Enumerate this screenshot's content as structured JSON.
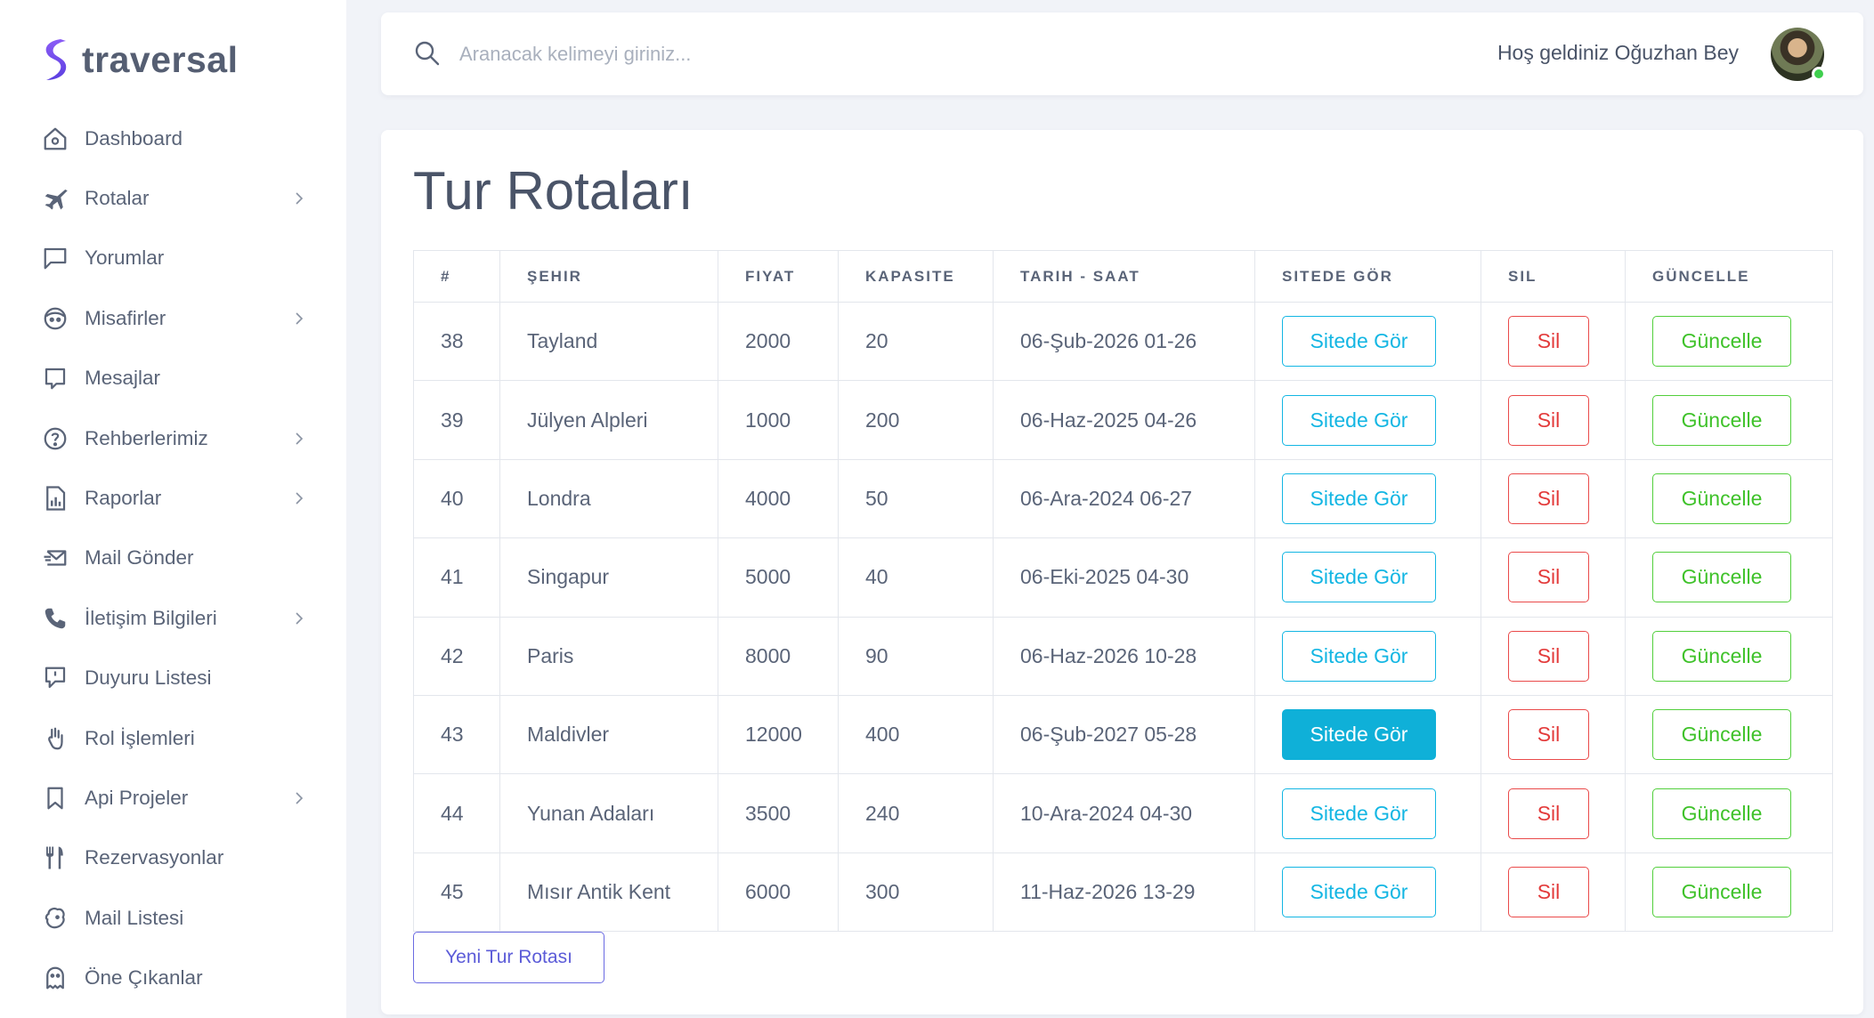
{
  "brand": {
    "name": "traversal",
    "accent": "#6c4cf4"
  },
  "sidebar": {
    "items": [
      {
        "label": "Dashboard",
        "icon": "home-icon",
        "has_children": false
      },
      {
        "label": "Rotalar",
        "icon": "plane-icon",
        "has_children": true
      },
      {
        "label": "Yorumlar",
        "icon": "message-square-icon",
        "has_children": false
      },
      {
        "label": "Misafirler",
        "icon": "face-icon",
        "has_children": true
      },
      {
        "label": "Mesajlar",
        "icon": "chat-icon",
        "has_children": false
      },
      {
        "label": "Rehberlerimiz",
        "icon": "help-circle-icon",
        "has_children": true
      },
      {
        "label": "Raporlar",
        "icon": "report-file-icon",
        "has_children": true
      },
      {
        "label": "Mail Gönder",
        "icon": "mail-send-icon",
        "has_children": false
      },
      {
        "label": "İletişim Bilgileri",
        "icon": "phone-icon",
        "has_children": true
      },
      {
        "label": "Duyuru Listesi",
        "icon": "announcement-icon",
        "has_children": false
      },
      {
        "label": "Rol İşlemleri",
        "icon": "hand-icon",
        "has_children": false
      },
      {
        "label": "Api Projeler",
        "icon": "bookmark-icon",
        "has_children": true
      },
      {
        "label": "Rezervasyonlar",
        "icon": "fork-knife-icon",
        "has_children": false
      },
      {
        "label": "Mail Listesi",
        "icon": "mailchimp-icon",
        "has_children": false
      },
      {
        "label": "Öne Çıkanlar",
        "icon": "ghost-icon",
        "has_children": false
      }
    ]
  },
  "header": {
    "search_placeholder": "Aranacak kelimeyi giriniz...",
    "welcome_text": "Hoş geldiniz Oğuzhan Bey",
    "online_status_color": "#3fcf4e"
  },
  "main": {
    "title": "Tur Rotaları",
    "columns": [
      "#",
      "ŞEHIR",
      "FIYAT",
      "KAPASITE",
      "TARIH - SAAT",
      "SITEDE GÖR",
      "SIL",
      "GÜNCELLE"
    ],
    "rows": [
      {
        "id": "38",
        "city": "Tayland",
        "price": "2000",
        "capacity": "20",
        "datetime": "06-Şub-2026 01-26",
        "view_label": "Sitede Gör",
        "delete_label": "Sil",
        "update_label": "Güncelle",
        "view_active": false
      },
      {
        "id": "39",
        "city": "Jülyen Alpleri",
        "price": "1000",
        "capacity": "200",
        "datetime": "06-Haz-2025 04-26",
        "view_label": "Sitede Gör",
        "delete_label": "Sil",
        "update_label": "Güncelle",
        "view_active": false
      },
      {
        "id": "40",
        "city": "Londra",
        "price": "4000",
        "capacity": "50",
        "datetime": "06-Ara-2024 06-27",
        "view_label": "Sitede Gör",
        "delete_label": "Sil",
        "update_label": "Güncelle",
        "view_active": false
      },
      {
        "id": "41",
        "city": "Singapur",
        "price": "5000",
        "capacity": "40",
        "datetime": "06-Eki-2025 04-30",
        "view_label": "Sitede Gör",
        "delete_label": "Sil",
        "update_label": "Güncelle",
        "view_active": false
      },
      {
        "id": "42",
        "city": "Paris",
        "price": "8000",
        "capacity": "90",
        "datetime": "06-Haz-2026 10-28",
        "view_label": "Sitede Gör",
        "delete_label": "Sil",
        "update_label": "Güncelle",
        "view_active": false
      },
      {
        "id": "43",
        "city": "Maldivler",
        "price": "12000",
        "capacity": "400",
        "datetime": "06-Şub-2027 05-28",
        "view_label": "Sitede Gör",
        "delete_label": "Sil",
        "update_label": "Güncelle",
        "view_active": true
      },
      {
        "id": "44",
        "city": "Yunan Adaları",
        "price": "3500",
        "capacity": "240",
        "datetime": "10-Ara-2024 04-30",
        "view_label": "Sitede Gör",
        "delete_label": "Sil",
        "update_label": "Güncelle",
        "view_active": false
      },
      {
        "id": "45",
        "city": "Mısır Antik Kent",
        "price": "6000",
        "capacity": "300",
        "datetime": "11-Haz-2026 13-29",
        "view_label": "Sitede Gör",
        "delete_label": "Sil",
        "update_label": "Güncelle",
        "view_active": false
      }
    ],
    "new_button_label": "Yeni Tur Rotası"
  },
  "colors": {
    "view_button": "#13b6e3",
    "delete_button": "#e33b3b",
    "update_button": "#3fc22a",
    "new_button": "#5b5bd8"
  }
}
